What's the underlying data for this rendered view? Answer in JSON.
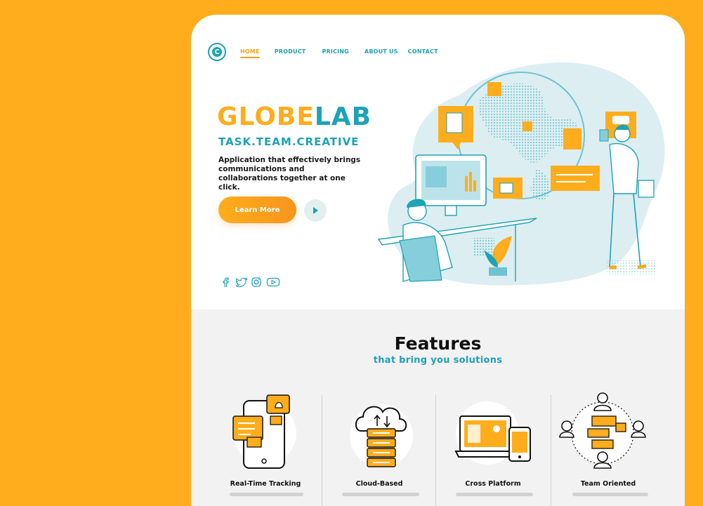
{
  "colors": {
    "background": "#FFAD1C",
    "accent_orange": "#FFAD1C",
    "accent_teal": "#1DA2B6",
    "features_bg": "#F2F2F2"
  },
  "nav": {
    "logo_icon": "globe-c-logo",
    "items": [
      {
        "label": "HOME",
        "active": true
      },
      {
        "label": "PRODUCT"
      },
      {
        "label": "PRICING"
      },
      {
        "label": "ABOUT US"
      },
      {
        "label": "CONTACT"
      }
    ]
  },
  "hero": {
    "title_part1": "GLOBE",
    "title_part2": "LAB",
    "tagline": "TASK.TEAM.CREATIVE",
    "description": "Application that effectively brings communications and collaborations together at one click.",
    "cta_label": "Learn More",
    "play_icon": "play-icon",
    "social_icons": [
      "facebook-icon",
      "twitter-icon",
      "instagram-icon",
      "youtube-icon"
    ]
  },
  "features": {
    "title": "Features",
    "subtitle": "that bring you solutions",
    "items": [
      {
        "name": "Real-Time Tracking",
        "icon": "phone-notifications-icon"
      },
      {
        "name": "Cloud-Based",
        "icon": "cloud-server-icon"
      },
      {
        "name": "Cross Platform",
        "icon": "laptop-phone-icon"
      },
      {
        "name": "Team Oriented",
        "icon": "team-people-icon"
      }
    ]
  }
}
